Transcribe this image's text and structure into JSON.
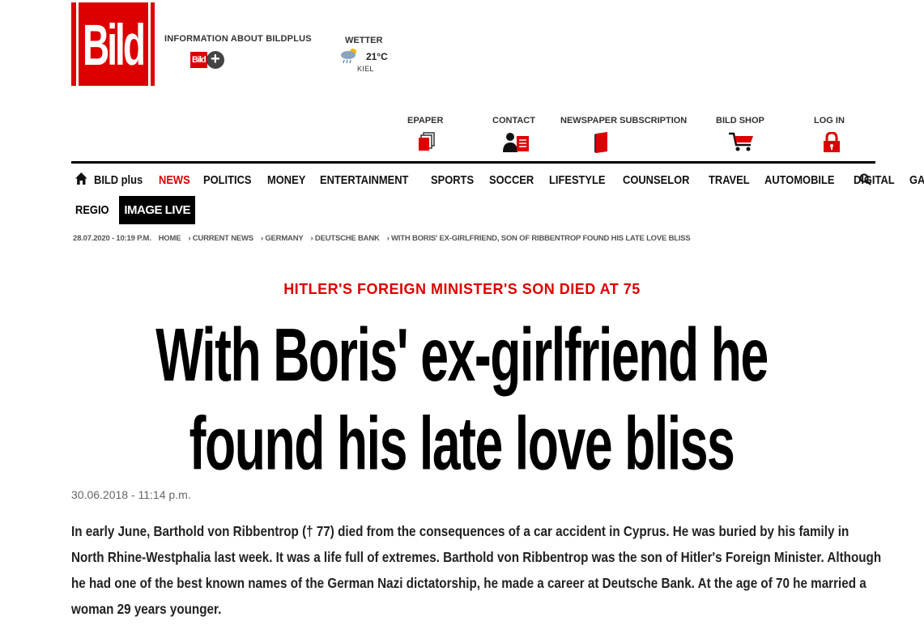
{
  "brand": {
    "logo_text": "Bild",
    "color": "#dd0000"
  },
  "bildplus": {
    "label": "INFORMATION ABOUT BILDPLUS",
    "badge_text": "Bild",
    "plus": "+"
  },
  "weather": {
    "label": "WETTER",
    "icon": "cloud-rain-sun-icon",
    "temperature": "21°C",
    "city": "KIEL"
  },
  "utility_nav": [
    {
      "label": "EPAPER",
      "icon": "epaper-icon"
    },
    {
      "label": "CONTACT",
      "icon": "contact-icon"
    },
    {
      "label": "NEWSPAPER SUBSCRIPTION",
      "icon": "newspaper-icon"
    },
    {
      "label": "BILD SHOP",
      "icon": "cart-icon"
    },
    {
      "label": "LOG IN",
      "icon": "lock-icon"
    }
  ],
  "main_nav": {
    "home_icon": "home-icon",
    "items": [
      "BILD plus",
      "NEWS",
      "POLITICS",
      "MONEY",
      "ENTERTAINMENT",
      "SPORTS",
      "SOCCER",
      "LIFESTYLE",
      "COUNSELOR",
      "TRAVEL",
      "AUTOMOBILE",
      "DIGITAL",
      "GAMES"
    ],
    "active": "NEWS",
    "row2": [
      "REGIO",
      "IMAGE LIVE"
    ],
    "search_icon": "search-icon"
  },
  "breadcrumb": {
    "timestamp": "28.07.2020 - 10:19 P.M.",
    "items": [
      "HOME",
      "› CURRENT NEWS",
      "› GERMANY",
      "› DEUTSCHE BANK",
      "› WITH BORIS' EX-GIRLFRIEND, SON OF RIBBENTROP FOUND HIS LATE LOVE BLISS"
    ]
  },
  "article": {
    "kicker": "HITLER'S FOREIGN MINISTER'S SON DIED AT 75",
    "headline_line1": "With Boris' ex-girlfriend he",
    "headline_line2": "found his late love bliss",
    "date": "30.06.2018 - 11:14 p.m.",
    "lead": "In early June, Barthold von Ribbentrop († 77) died from the consequences of a car accident in Cyprus. He was buried by his family in North Rhine-Westphalia last week. It was a life full of extremes. Barthold von Ribbentrop was the son of Hitler's Foreign Minister. Although he had one of the best known names of the German Nazi dictatorship, he made a career at Deutsche Bank. At the age of 70 he married a woman 29 years younger."
  }
}
